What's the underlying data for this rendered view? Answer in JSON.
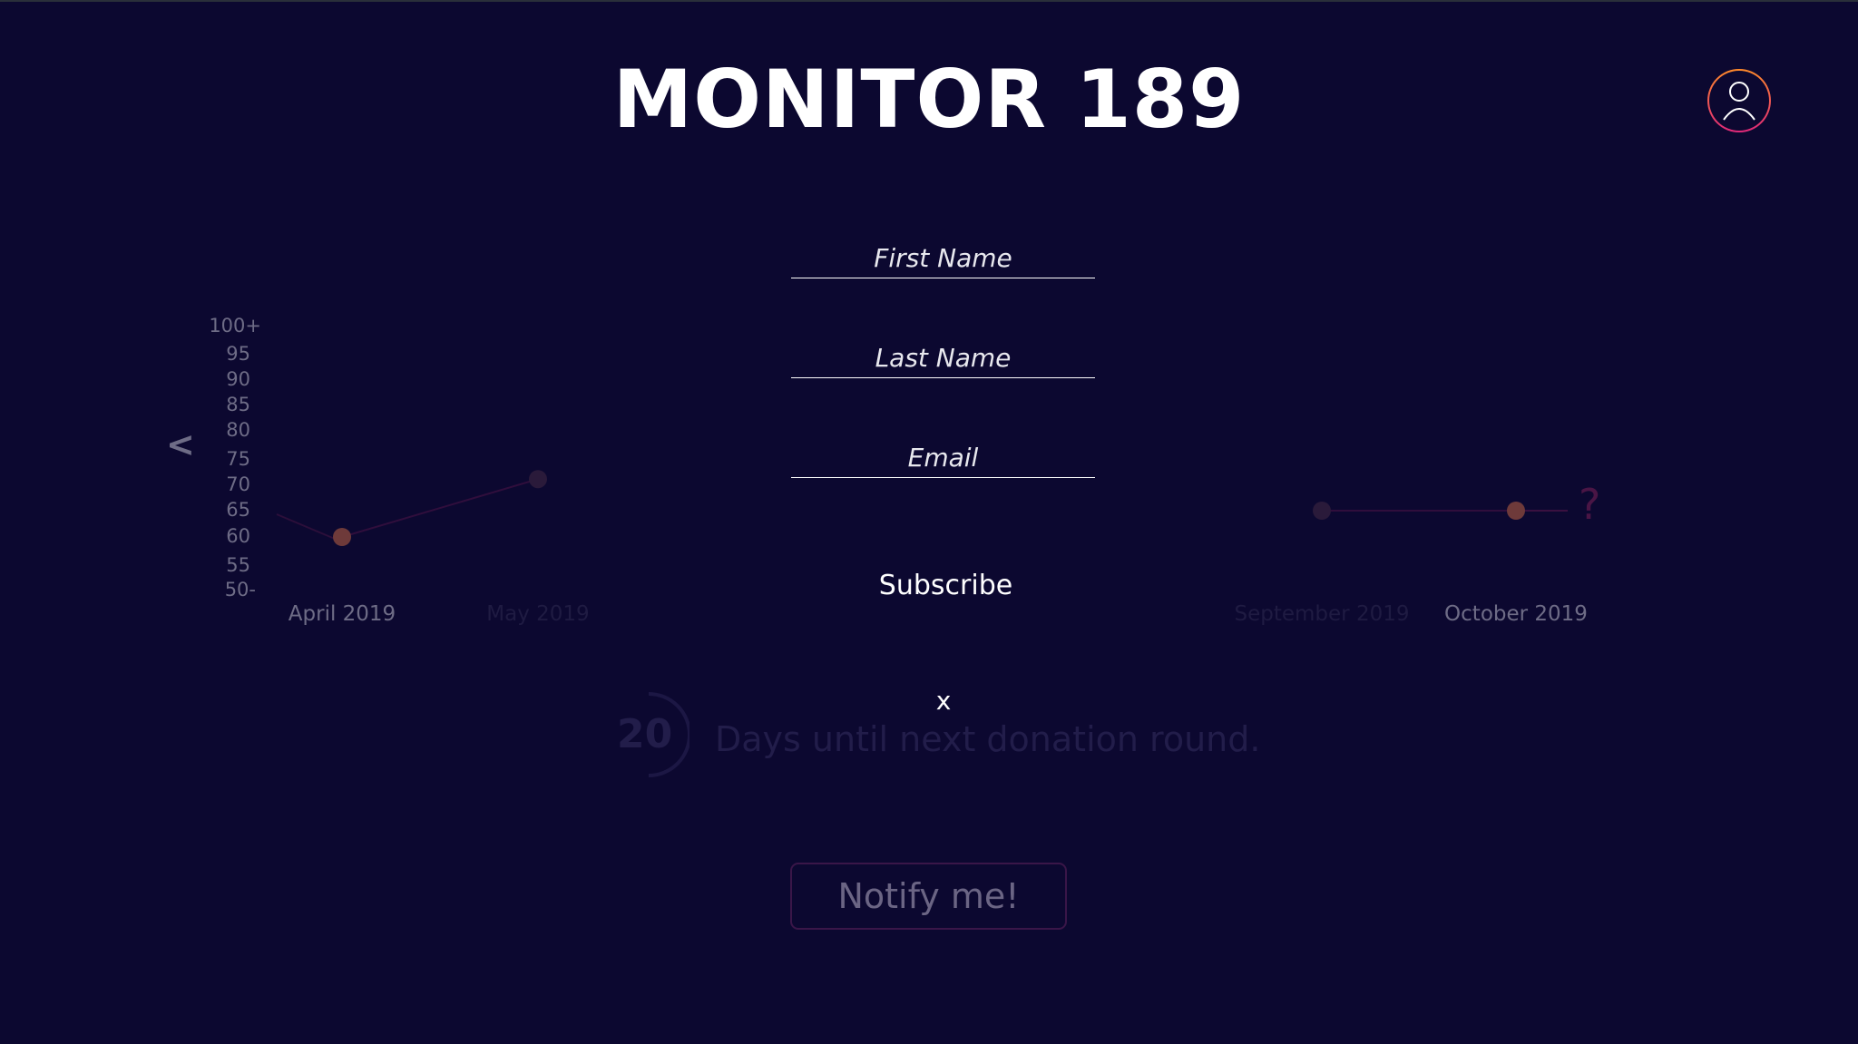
{
  "app": {
    "title": "MONITOR 189"
  },
  "header": {
    "profile_icon": "user-icon",
    "profile_ring_colors": [
      "#ff8a2a",
      "#e0287a"
    ]
  },
  "colors": {
    "background": "#0c0830",
    "accent": "#e0287a",
    "point": "#7a3a3a"
  },
  "chart_data": {
    "type": "line",
    "y_ticks": [
      "100+",
      "95",
      "90",
      "85",
      "80",
      "75",
      "70",
      "65",
      "60",
      "55",
      "50-"
    ],
    "ylim": [
      50,
      100
    ],
    "categories": [
      "April 2019",
      "May 2019",
      "September 2019",
      "October 2019"
    ],
    "values": [
      60,
      71,
      65,
      65
    ],
    "future_marker": "?",
    "prev_arrow": "<"
  },
  "countdown": {
    "value": "20",
    "text": "Days until next donation round."
  },
  "notify": {
    "label": "Notify me!"
  },
  "form": {
    "first_name_placeholder": "First Name",
    "last_name_placeholder": "Last Name",
    "email_placeholder": "Email",
    "subscribe_label": "Subscribe",
    "close_label": "x"
  }
}
